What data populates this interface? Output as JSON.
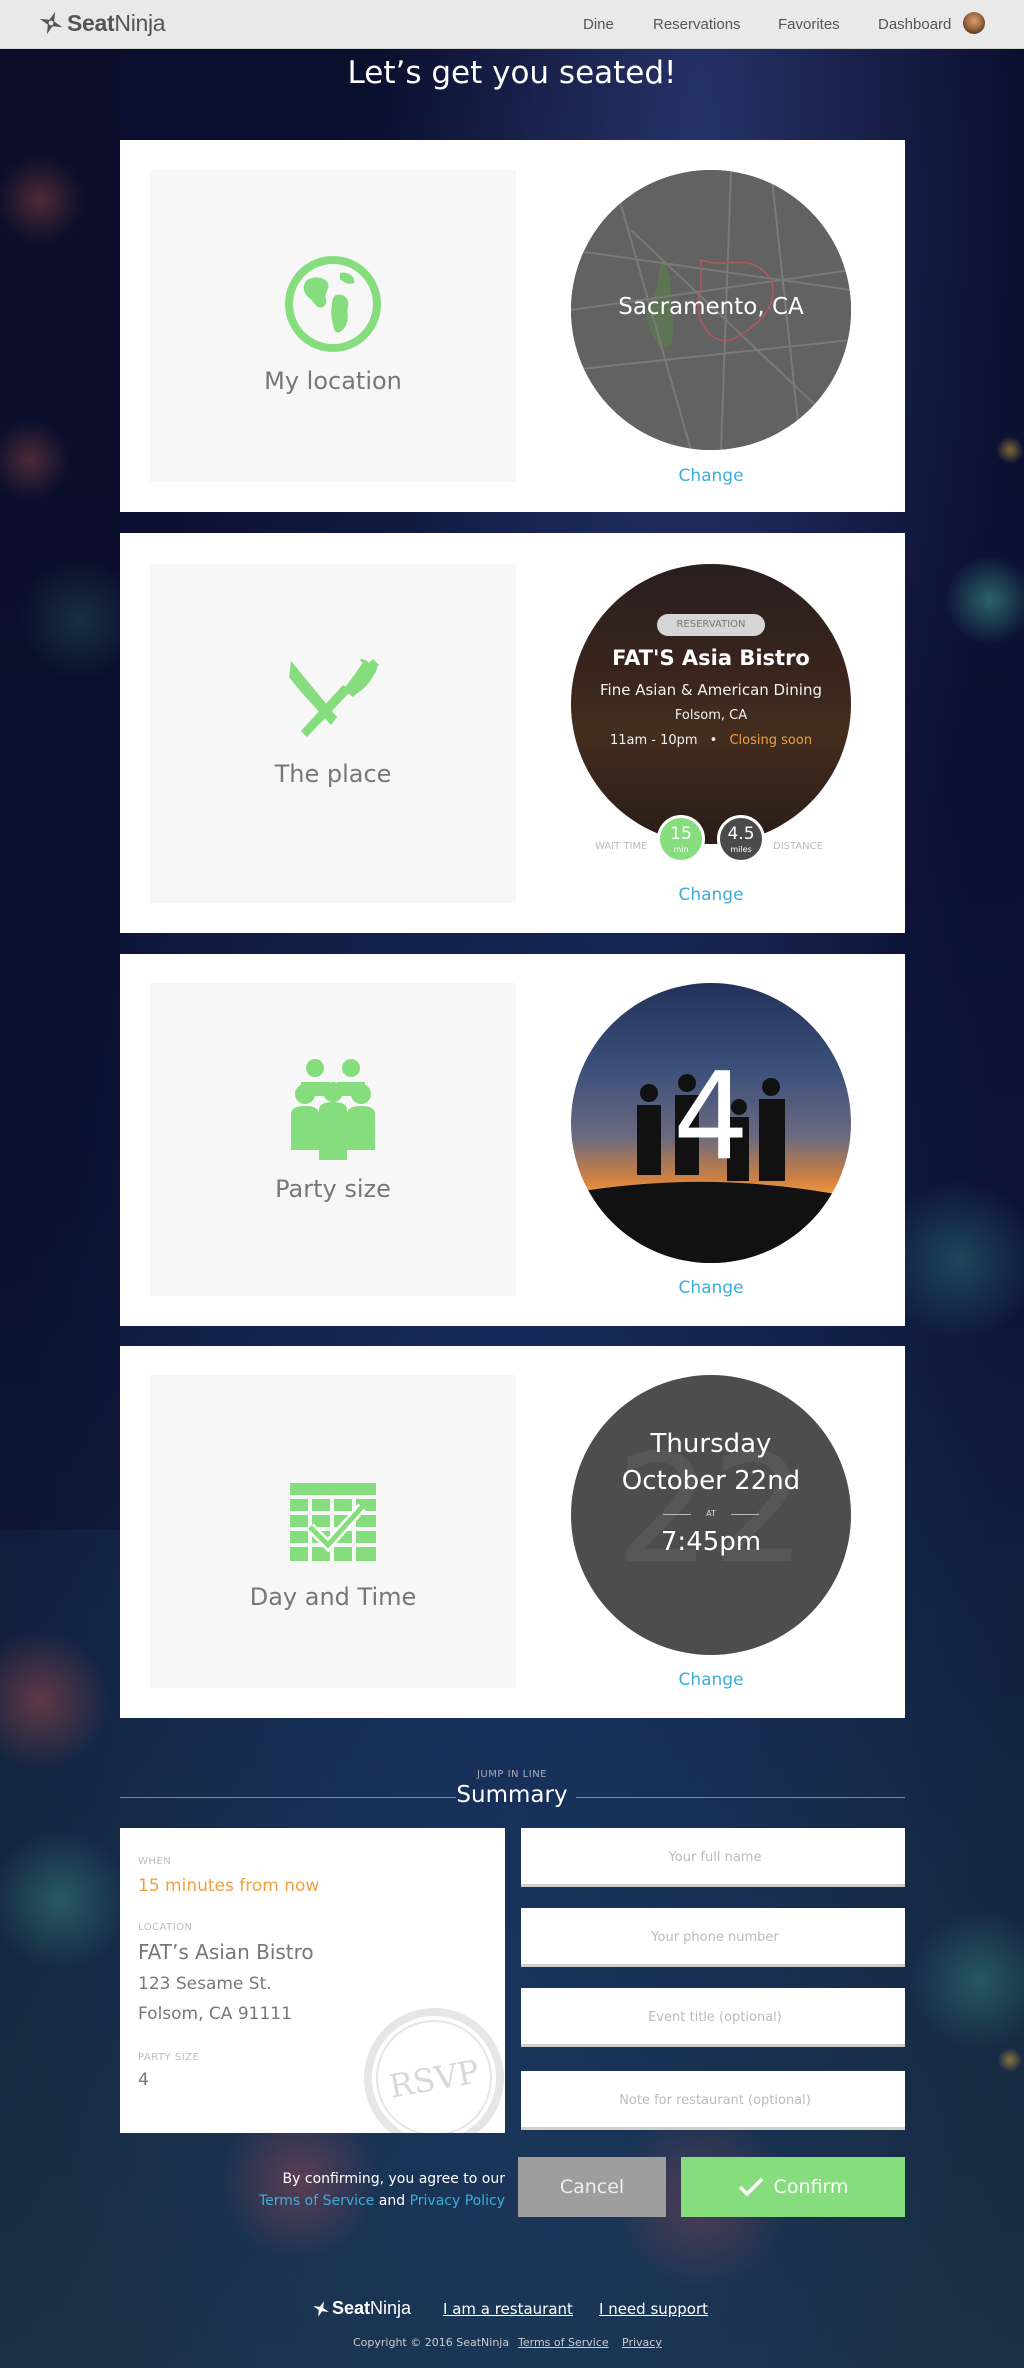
{
  "brand": {
    "name_bold": "Seat",
    "name_light": "Ninja",
    "accent": "#86dd7e",
    "link_color": "#3aaed8"
  },
  "nav": {
    "items": [
      {
        "label": "Dine"
      },
      {
        "label": "Reservations"
      },
      {
        "label": "Favorites"
      },
      {
        "label": "Dashboard"
      }
    ]
  },
  "page": {
    "title": "Let’s get you seated!"
  },
  "steps": {
    "location": {
      "label": "My location",
      "icon": "globe-icon",
      "value": "Sacramento, CA",
      "change": "Change"
    },
    "place": {
      "label": "The place",
      "icon": "fork-knife-icon",
      "badge": "RESERVATION",
      "name": "FAT'S Asia Bistro",
      "cuisine": "Fine Asian & American Dining",
      "city": "Folsom, CA",
      "hours": "11am - 10pm",
      "bullet": "•",
      "status": "Closing soon",
      "wait_label": "WAIT TIME",
      "wait_value": "15",
      "wait_unit": "min",
      "distance_value": "4.5",
      "distance_unit": "miles",
      "distance_label": "DISTANCE",
      "change": "Change"
    },
    "party": {
      "label": "Party size",
      "icon": "people-group-icon",
      "value": "4",
      "change": "Change"
    },
    "datetime": {
      "label": "Day and Time",
      "icon": "calendar-check-icon",
      "day": "Thursday",
      "date": "October 22nd",
      "at": "AT",
      "time": "7:45pm",
      "bg_number": "22",
      "change": "Change"
    }
  },
  "summary": {
    "kicker": "JUMP IN LINE",
    "title": "Summary",
    "when_label": "WHEN",
    "when_value": "15 minutes from now",
    "location_label": "LOCATION",
    "location_name": "FAT’s Asian Bistro",
    "address1": "123 Sesame St.",
    "address2": "Folsom, CA 91111",
    "party_label": "PARTY SIZE",
    "party_value": "4",
    "stamp": "RSVP"
  },
  "form": {
    "name_placeholder": "Your full name",
    "phone_placeholder": "Your phone number",
    "event_placeholder": "Event title (optional)",
    "note_placeholder": "Note for restaurant (optional)",
    "agree_text": "By confirming, you agree to our",
    "terms": "Terms of Service",
    "and": "and",
    "privacy": "Privacy Policy",
    "cancel": "Cancel",
    "confirm": "Confirm"
  },
  "footer": {
    "restaurant_link": "I am a restaurant",
    "support_link": "I need support",
    "copyright": "Copyright © 2016 SeatNinja",
    "terms": "Terms of Service",
    "privacy": "Privacy"
  }
}
